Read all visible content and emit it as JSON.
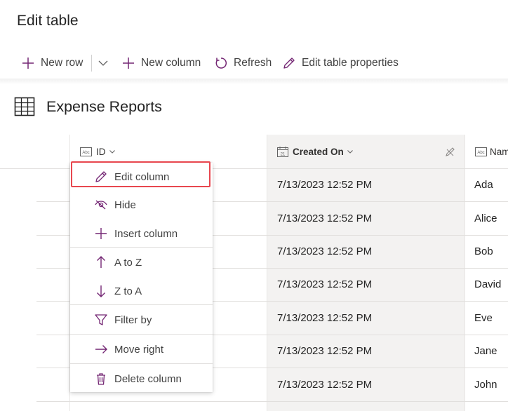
{
  "page": {
    "title": "Edit table"
  },
  "toolbar": {
    "new_row": "New row",
    "new_column": "New column",
    "refresh": "Refresh",
    "edit_props": "Edit table properties"
  },
  "table": {
    "name": "Expense Reports",
    "columns": {
      "id": "ID",
      "created_on": "Created On",
      "name": "Nam"
    },
    "rows": [
      {
        "created": "7/13/2023 12:52 PM",
        "name": "Ada"
      },
      {
        "created": "7/13/2023 12:52 PM",
        "name": "Alice"
      },
      {
        "created": "7/13/2023 12:52 PM",
        "name": "Bob"
      },
      {
        "created": "7/13/2023 12:52 PM",
        "name": "David"
      },
      {
        "created": "7/13/2023 12:52 PM",
        "name": "Eve"
      },
      {
        "created": "7/13/2023 12:52 PM",
        "name": "Jane"
      },
      {
        "created": "7/13/2023 12:52 PM",
        "name": "John"
      }
    ]
  },
  "menu": {
    "edit_column": "Edit column",
    "hide": "Hide",
    "insert_column": "Insert column",
    "a_to_z": "A to Z",
    "z_to_a": "Z to A",
    "filter_by": "Filter by",
    "move_right": "Move right",
    "delete_column": "Delete column"
  },
  "colors": {
    "accent": "#742774",
    "highlight": "#e8474f"
  }
}
